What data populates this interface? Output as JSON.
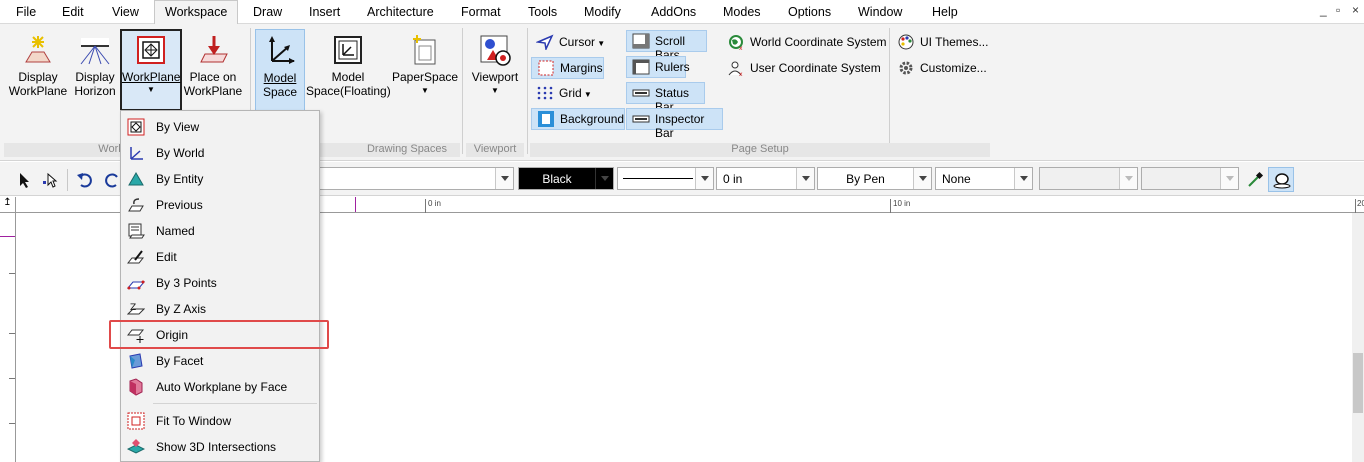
{
  "menu": [
    "File",
    "Edit",
    "View",
    "Workspace",
    "Draw",
    "Insert",
    "Architecture",
    "Format",
    "Tools",
    "Modify",
    "AddOns",
    "Modes",
    "Options",
    "Window",
    "Help"
  ],
  "window_controls": [
    "_",
    "▫",
    "×"
  ],
  "ribbon": {
    "display_workplane": [
      "Display",
      "WorkPlane"
    ],
    "display_horizon": [
      "Display",
      "Horizon"
    ],
    "workplane": [
      "WorkPlane"
    ],
    "place_on_workplane": [
      "Place on",
      "WorkPlane"
    ],
    "model_space": [
      "Model",
      "Space"
    ],
    "model_space_floating": [
      "Model",
      "Space(Floating)"
    ],
    "paperspace": [
      "PaperSpace"
    ],
    "viewport": [
      "Viewport"
    ],
    "page_setup": {
      "cursor": "Cursor",
      "margins": "Margins",
      "grid": "Grid",
      "background": "Background",
      "scroll_bars": "Scroll Bars",
      "rulers": "Rulers",
      "status_bar": "Status Bar",
      "inspector_bar": "Inspector Bar",
      "world_cs": "World Coordinate System",
      "user_cs": "User Coordinate System",
      "ui_themes": "UI Themes...",
      "customize": "Customize..."
    },
    "groups": {
      "workplane": "Work",
      "drawing_spaces": "Drawing Spaces",
      "viewport": "Viewport",
      "page_setup": "Page Setup"
    }
  },
  "toolbar": {
    "color": "Black",
    "line_width": "0 in",
    "pen": "By Pen",
    "fill": "None"
  },
  "ruler": {
    "mark_0": "0 in",
    "mark_10": "10 in",
    "mark_20": "20"
  },
  "workplane_menu": [
    {
      "label": "By View",
      "icon": "workplane-by-view-icon"
    },
    {
      "label": "By World",
      "icon": "workplane-by-world-icon"
    },
    {
      "label": "By Entity",
      "icon": "workplane-by-entity-icon"
    },
    {
      "label": "Previous",
      "icon": "workplane-previous-icon"
    },
    {
      "label": "Named",
      "icon": "workplane-named-icon"
    },
    {
      "label": "Edit",
      "icon": "workplane-edit-icon"
    },
    {
      "label": "By 3 Points",
      "icon": "workplane-3-points-icon"
    },
    {
      "label": "By Z Axis",
      "icon": "workplane-z-axis-icon"
    },
    {
      "label": "Origin",
      "icon": "workplane-origin-icon"
    },
    {
      "label": "By Facet",
      "icon": "workplane-by-facet-icon"
    },
    {
      "label": "Auto Workplane by Face",
      "icon": "auto-workplane-icon"
    },
    {
      "label": "Fit To Window",
      "icon": "fit-to-window-icon"
    },
    {
      "label": "Show 3D Intersections",
      "icon": "show-3d-intersections-icon"
    }
  ],
  "colors": {
    "highlight": "#e04a4a",
    "selected": "#cde3f7",
    "ribbon_bg": "#f3f3f3"
  }
}
